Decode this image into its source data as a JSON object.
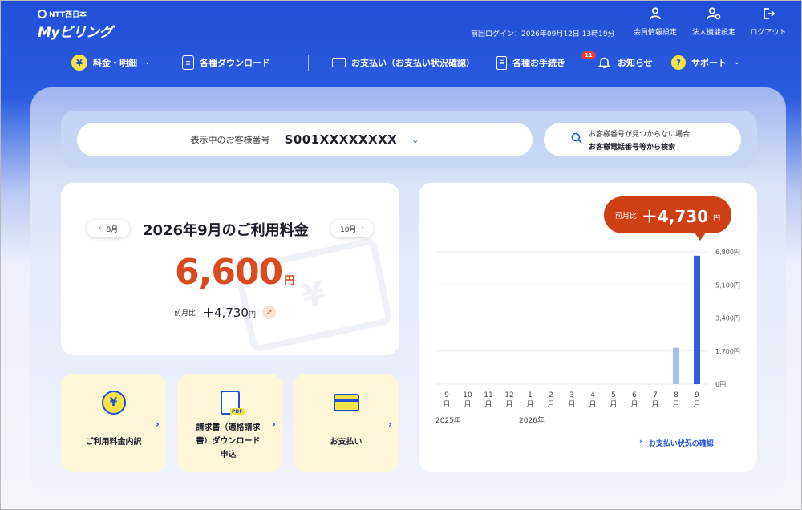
{
  "header": {
    "ntt_logo": "NTT西日本",
    "brand": "Myビリング",
    "last_login": "前回ログイン：2026年09月12日 13時19分",
    "links": [
      {
        "label": "会員情報設定",
        "icon": "person-icon"
      },
      {
        "label": "法人機能設定",
        "icon": "person-gear-icon"
      },
      {
        "label": "ログアウト",
        "icon": "logout-icon"
      }
    ]
  },
  "nav": {
    "items": [
      {
        "label": "料金・明細",
        "icon": "yen-icon",
        "has_chevron": true
      },
      {
        "label": "各種ダウンロード",
        "icon": "document-download-icon"
      },
      {
        "label": "お支払い（お支払い状況確認）",
        "icon": "card-icon"
      },
      {
        "label": "各種お手続き",
        "icon": "checklist-icon"
      },
      {
        "label": "お知らせ",
        "icon": "bell-icon",
        "badge": "11"
      },
      {
        "label": "サポート",
        "icon": "chat-help-icon",
        "has_chevron": true
      }
    ]
  },
  "account": {
    "label": "表示中のお客様番号",
    "value": "S001XXXXXXXX",
    "phone_search_hint": "お客様番号が見つからない場合",
    "phone_search_label": "お客様電話番号等から検索"
  },
  "usage": {
    "prev_month": "8月",
    "next_month": "10月",
    "title": "2026年9月のご利用料金",
    "amount": "6,600",
    "currency": "円",
    "diff_label": "前月比",
    "diff_value": "＋4,730",
    "diff_unit": "円"
  },
  "tiles": [
    {
      "label": "ご利用料金内訳",
      "icon": "yen-circle-icon"
    },
    {
      "label": "請求書（適格請求書）ダウンロード申込",
      "icon": "pdf-icon"
    },
    {
      "label": "お支払い",
      "icon": "credit-card-icon"
    }
  ],
  "bubble": {
    "label": "前月比",
    "value": "＋4,730",
    "unit": "円"
  },
  "pay_link": "お支払い状況の確認",
  "chart_data": {
    "type": "bar",
    "categories": [
      "9月",
      "10月",
      "11月",
      "12月",
      "1月",
      "2月",
      "3月",
      "4月",
      "5月",
      "6月",
      "7月",
      "8月",
      "9月"
    ],
    "year_labels": [
      {
        "label": "2025年",
        "at": 0
      },
      {
        "label": "2026年",
        "at": 4
      }
    ],
    "series": [
      {
        "values": [
          0,
          0,
          0,
          0,
          0,
          0,
          0,
          0,
          0,
          0,
          0,
          1870,
          6600
        ]
      }
    ],
    "y_ticks": [
      "0円",
      "1,700円",
      "3,400円",
      "5,100円",
      "6,800円"
    ],
    "ylim": [
      0,
      6800
    ],
    "highlight_index": 12,
    "colors": {
      "current": "#2f5fdc",
      "previous": "#a8bdf0"
    },
    "grid": true
  },
  "colors": {
    "brand_blue": "#1f4fd6",
    "accent_red": "#cf3f16",
    "yellow": "#f8e24a"
  }
}
